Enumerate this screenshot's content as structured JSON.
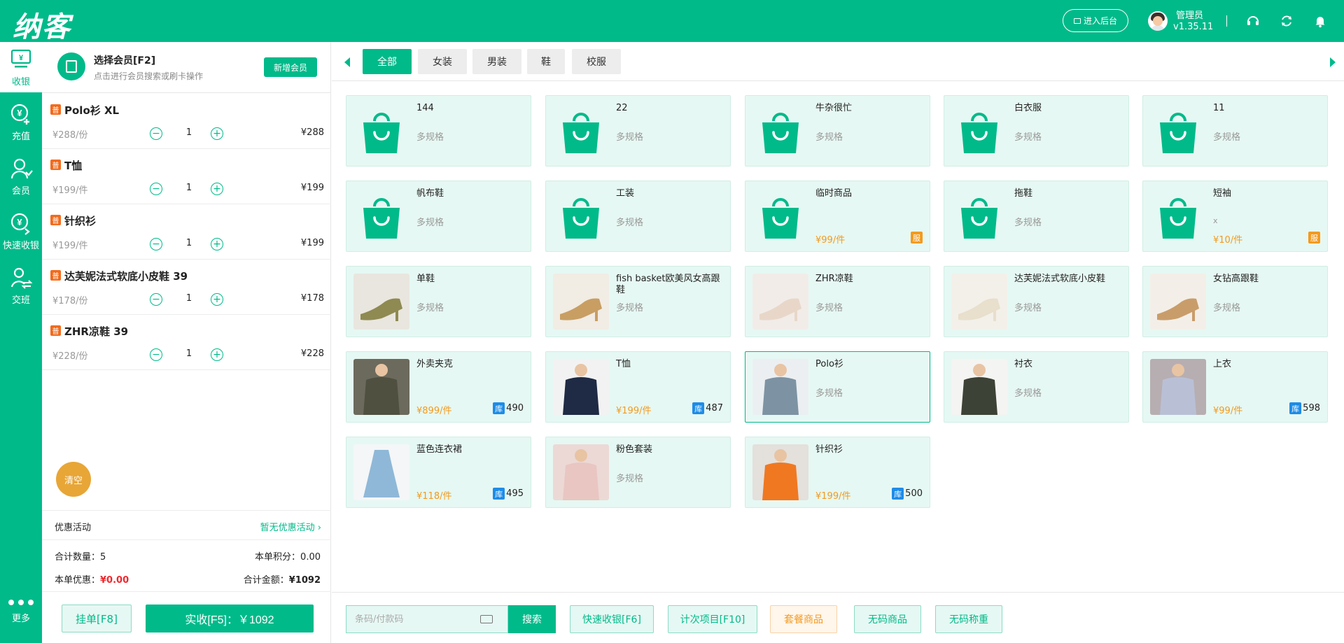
{
  "header": {
    "logo": "纳客",
    "admin_button": "进入后台",
    "user_name": "管理员",
    "version": "v1.35.11"
  },
  "nav": [
    {
      "label": "收银",
      "icon": "cashier-icon",
      "active": true
    },
    {
      "label": "充值",
      "icon": "recharge-icon",
      "active": false
    },
    {
      "label": "会员",
      "icon": "member-icon",
      "active": false
    },
    {
      "label": "快速收银",
      "icon": "quick-cash-icon",
      "active": false
    },
    {
      "label": "交班",
      "icon": "shift-icon",
      "active": false
    }
  ],
  "nav_more": "更多",
  "member": {
    "title": "选择会员[F2]",
    "subtitle": "点击进行会员搜索或刷卡操作",
    "new_button": "新增会员"
  },
  "cart_items": [
    {
      "badge": "普",
      "name": "Polo衫 XL",
      "unit_price": "¥288/份",
      "qty": "1",
      "total": "¥288"
    },
    {
      "badge": "普",
      "name": "T恤",
      "unit_price": "¥199/件",
      "qty": "1",
      "total": "¥199"
    },
    {
      "badge": "普",
      "name": "针织衫",
      "unit_price": "¥199/件",
      "qty": "1",
      "total": "¥199"
    },
    {
      "badge": "普",
      "name": "达芙妮法式软底小皮鞋 39",
      "unit_price": "¥178/份",
      "qty": "1",
      "total": "¥178"
    },
    {
      "badge": "普",
      "name": "ZHR凉鞋 39",
      "unit_price": "¥228/份",
      "qty": "1",
      "total": "¥228"
    }
  ],
  "cart_controls": {
    "minus": "−",
    "plus": "+"
  },
  "clear_button": "清空",
  "promo": {
    "label": "优惠活动",
    "value": "暂无优惠活动 ›"
  },
  "summary": {
    "qty_label": "合计数量：",
    "qty_value": "5",
    "points_label": "本单积分：",
    "points_value": "0.00",
    "discount_label": "本单优惠：",
    "discount_value": "¥0.00",
    "total_label": "合计金额：",
    "total_value": "¥1092"
  },
  "hold_button": "挂单[F8]",
  "pay_button": "实收[F5]：￥1092",
  "tabs": [
    "全部",
    "女装",
    "男装",
    "鞋",
    "校服"
  ],
  "colors": {
    "brand": "#00BA8A",
    "card_bg": "#E6F8F3",
    "price": "#F39A1F",
    "stock_badge": "#1E8CE8",
    "discount": "#F0282D"
  },
  "stock_badge": "库",
  "fu_badge": "服",
  "products": [
    {
      "name": "144",
      "spec": "多规格",
      "image": "bag-icon"
    },
    {
      "name": "22",
      "spec": "多规格",
      "image": "bag-icon"
    },
    {
      "name": "牛杂很忙",
      "spec": "多规格",
      "image": "bag-icon"
    },
    {
      "name": "白衣服",
      "spec": "多规格",
      "image": "bag-icon"
    },
    {
      "name": "11",
      "spec": "多规格",
      "image": "bag-icon"
    },
    {
      "name": "帆布鞋",
      "spec": "多规格",
      "image": "bag-icon"
    },
    {
      "name": "工装",
      "spec": "多规格",
      "image": "bag-icon"
    },
    {
      "name": "临时商品",
      "price": "¥99/件",
      "image": "bag-icon",
      "fu": true
    },
    {
      "name": "拖鞋",
      "spec": "多规格",
      "image": "bag-icon"
    },
    {
      "name": "短袖",
      "note": "x",
      "price": "¥10/件",
      "image": "bag-icon",
      "fu": true
    },
    {
      "name": "单鞋",
      "spec": "多规格",
      "image": "flat-shoe-photo"
    },
    {
      "name": "fish basket欧美风女高跟鞋",
      "spec": "多规格",
      "image": "gold-heel-photo"
    },
    {
      "name": "ZHR凉鞋",
      "spec": "多规格",
      "image": "sandal-photo"
    },
    {
      "name": "达芙妮法式软底小皮鞋",
      "spec": "多规格",
      "image": "loafer-photo"
    },
    {
      "name": "女钻高跟鞋",
      "spec": "多规格",
      "image": "beige-heel-photo"
    },
    {
      "name": "外卖夹克",
      "price": "¥899/件",
      "stock": "490",
      "image": "jacket-photo"
    },
    {
      "name": "T恤",
      "price": "¥199/件",
      "stock": "487",
      "image": "tshirt-photo"
    },
    {
      "name": "Polo衫",
      "spec": "多规格",
      "image": "polo-photo",
      "selected": true
    },
    {
      "name": "衬衣",
      "spec": "多规格",
      "image": "shirt-photo"
    },
    {
      "name": "上衣",
      "price": "¥99/件",
      "stock": "598",
      "image": "top-photo"
    },
    {
      "name": "蓝色连衣裙",
      "price": "¥118/件",
      "stock": "495",
      "image": "blue-dress-photo"
    },
    {
      "name": "粉色套装",
      "spec": "多规格",
      "image": "pink-suit-photo"
    },
    {
      "name": "针织衫",
      "price": "¥199/件",
      "stock": "500",
      "image": "orange-knit-photo"
    }
  ],
  "search": {
    "placeholder": "条码/付款码",
    "button": "搜索"
  },
  "bottom_buttons": [
    {
      "label": "快速收银[F6]",
      "style": "green"
    },
    {
      "label": "计次项目[F10]",
      "style": "green"
    },
    {
      "label": "套餐商品",
      "style": "orange"
    },
    {
      "label": "无码商品",
      "style": "green"
    },
    {
      "label": "无码称重",
      "style": "green"
    }
  ]
}
